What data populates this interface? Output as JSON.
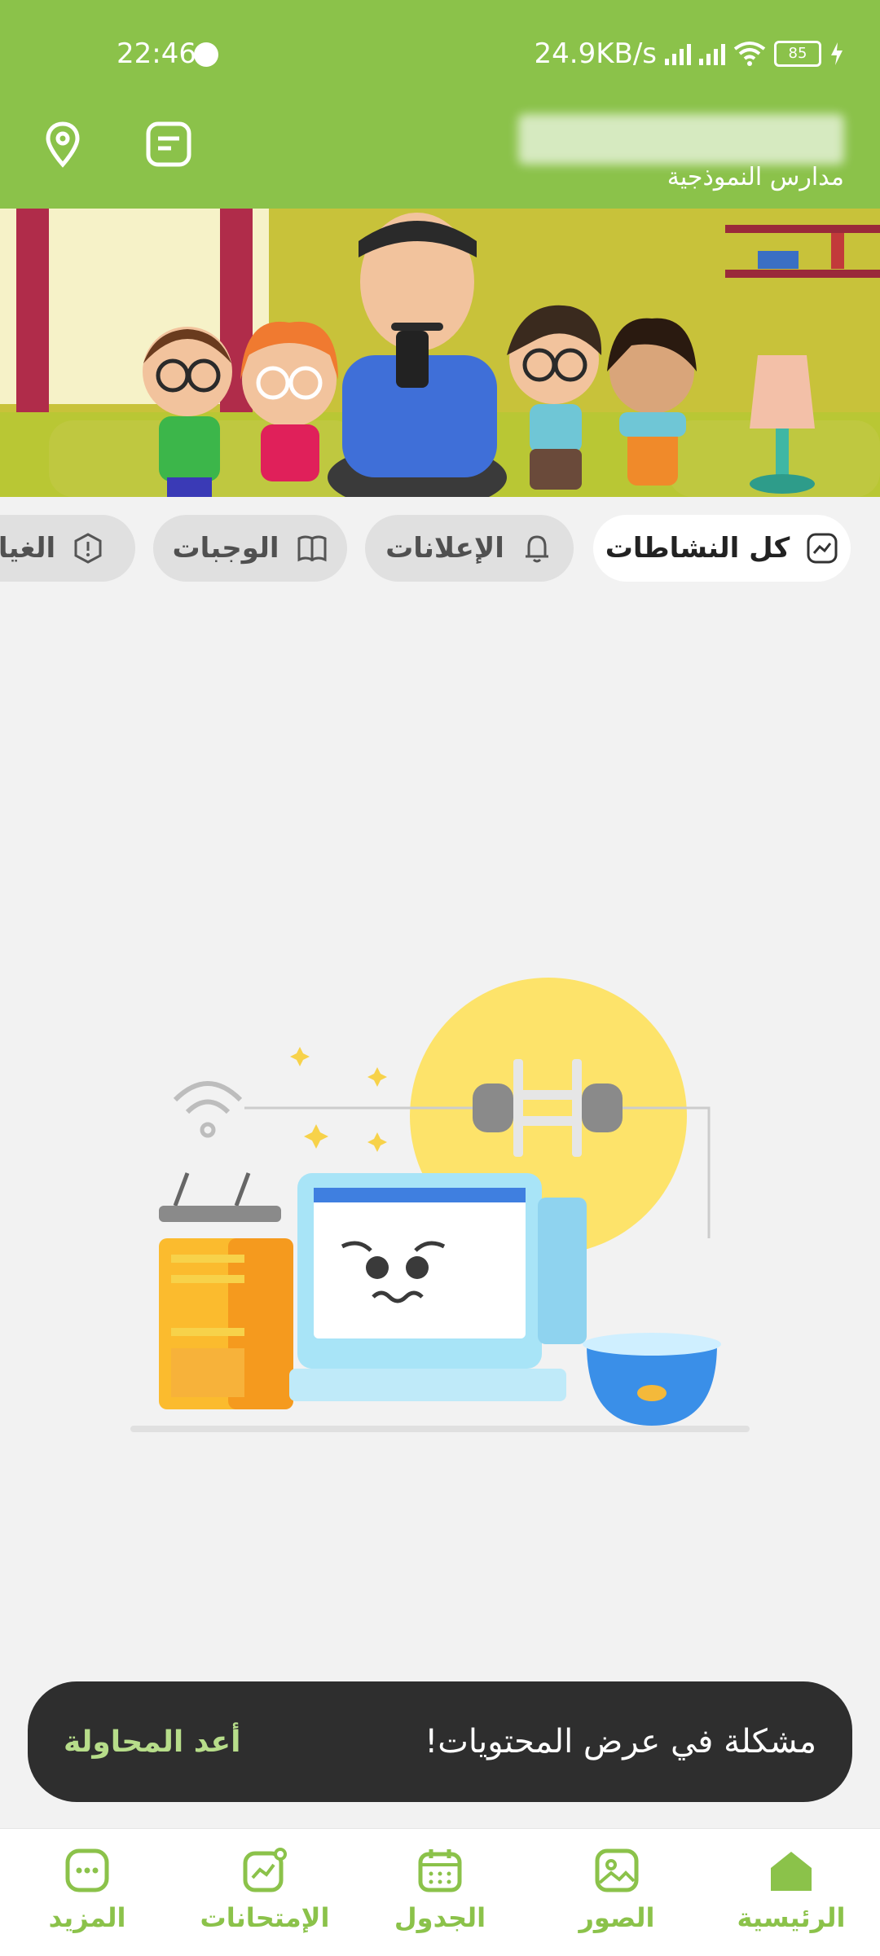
{
  "status_bar": {
    "time": "22:46",
    "network_speed": "24.9KB/s",
    "battery": "85"
  },
  "header": {
    "school_name": "مدارس النموذجية",
    "icons": [
      "location-icon",
      "notes-icon"
    ]
  },
  "tabs": [
    {
      "label": "كل النشاطات",
      "icon": "chart-icon",
      "active": true
    },
    {
      "label": "الإعلانات",
      "icon": "bell-icon",
      "active": false
    },
    {
      "label": "الوجبات",
      "icon": "book-icon",
      "active": false
    },
    {
      "label": "الغيا",
      "icon": "alert-icon",
      "active": false
    }
  ],
  "snackbar": {
    "message": "مشكلة في عرض المحتويات!",
    "action": "أعد المحاولة"
  },
  "bottom_nav": [
    {
      "label": "الرئيسية",
      "icon": "home-icon"
    },
    {
      "label": "الصور",
      "icon": "image-icon"
    },
    {
      "label": "الجدول",
      "icon": "calendar-icon"
    },
    {
      "label": "الإمتحانات",
      "icon": "exam-chart-icon"
    },
    {
      "label": "المزيد",
      "icon": "more-icon"
    }
  ],
  "colors": {
    "brand": "#8bc24a",
    "snackbar": "#2e2e2e",
    "snack_action": "#b7dd8a"
  }
}
